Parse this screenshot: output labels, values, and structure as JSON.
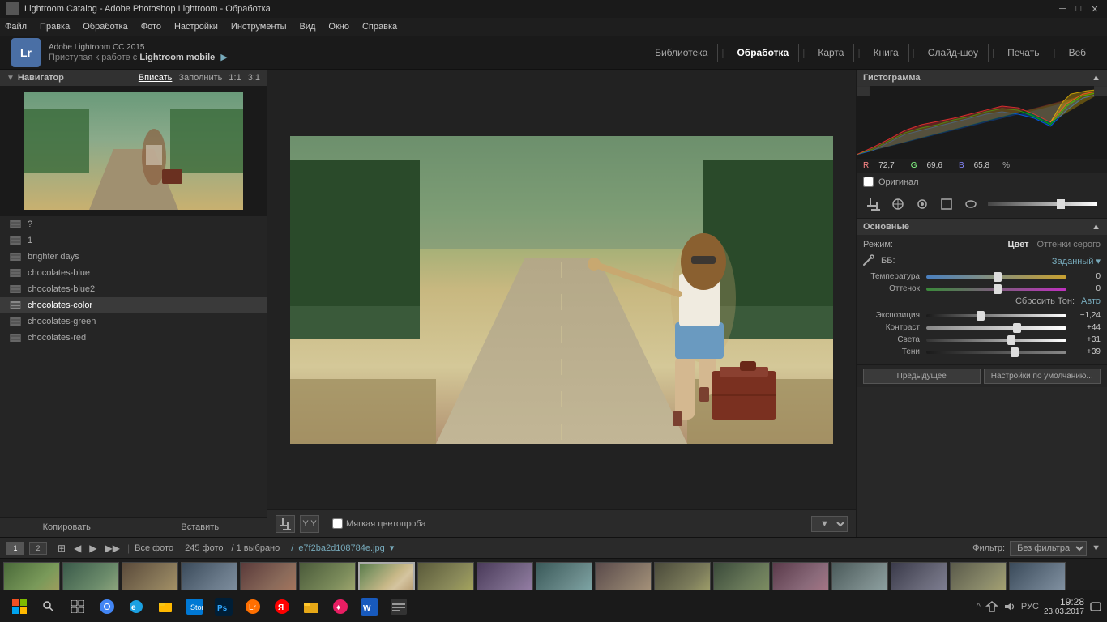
{
  "titleBar": {
    "title": "Lightroom Catalog - Adobe Photoshop Lightroom - Обработка"
  },
  "menuBar": {
    "items": [
      "Файл",
      "Правка",
      "Обработка",
      "Фото",
      "Настройки",
      "Инструменты",
      "Вид",
      "Окно",
      "Справка"
    ]
  },
  "topNav": {
    "logo": "Lr",
    "appName": "Adobe Lightroom CC 2015",
    "mobileText": "Приступая к работе с",
    "mobileBold": "Lightroom mobile",
    "navItems": [
      {
        "label": "Библиотека",
        "active": false
      },
      {
        "label": "Обработка",
        "active": true
      },
      {
        "label": "Карта",
        "active": false
      },
      {
        "label": "Книга",
        "active": false
      },
      {
        "label": "Слайд-шоу",
        "active": false
      },
      {
        "label": "Печать",
        "active": false
      },
      {
        "label": "Веб",
        "active": false
      }
    ]
  },
  "navigator": {
    "label": "Навигатор",
    "zoomOptions": [
      "Вписать",
      "Заполнить",
      "1:1",
      "3:1"
    ],
    "activeZoom": "Вписать"
  },
  "presets": {
    "items": [
      {
        "name": "?",
        "active": false
      },
      {
        "name": "1",
        "active": false
      },
      {
        "name": "brighter days",
        "active": false
      },
      {
        "name": "chocolates-blue",
        "active": false
      },
      {
        "name": "chocolates-blue2",
        "active": false
      },
      {
        "name": "chocolates-color",
        "active": true
      },
      {
        "name": "chocolates-green",
        "active": false
      },
      {
        "name": "chocolates-red",
        "active": false
      }
    ],
    "copyLabel": "Копировать",
    "pasteLabel": "Вставить"
  },
  "histogram": {
    "label": "Гистограмма",
    "r": "72,7",
    "g": "69,6",
    "b": "65,8",
    "percent": "%"
  },
  "originalToggle": {
    "label": "Оригинал"
  },
  "basicPanel": {
    "label": "Основные",
    "modeLabel": "Режим:",
    "modeValue": "Цвет",
    "modeAlt": "Оттенки серого",
    "bbLabel": "ББ:",
    "bbValue": "Заданный",
    "tempLabel": "Температура",
    "tempValue": "0",
    "tintLabel": "Оттенок",
    "tintValue": "0",
    "resetToneLabel": "Сбросить Тон:",
    "resetToneValue": "Авто",
    "exposureLabel": "Экспозиция",
    "exposureValue": "−1,24",
    "contrastLabel": "Контраст",
    "contrastValue": "+44",
    "highlightsLabel": "Света",
    "highlightsValue": "+31",
    "shadowsLabel": "Тени",
    "shadowsValue": "+39"
  },
  "bottomPanel": {
    "prevLabel": "Предыдущее",
    "defaultLabel": "Настройки по умолчанию..."
  },
  "imageToolbar": {
    "softproofLabel": "Мягкая цветопроба"
  },
  "filmstrip": {
    "toolbar": {
      "tab1": "1",
      "tab2": "2",
      "allPhotos": "Все фото",
      "count": "245 фото",
      "selected": "/ 1 выбрано",
      "filename": "e7f2ba2d108784e.jpg",
      "filterLabel": "Фильтр:",
      "filterValue": "Без фильтра"
    }
  },
  "taskbar": {
    "clock": {
      "time": "19:28",
      "date": "23.03.2017"
    },
    "lang": "РУС"
  }
}
